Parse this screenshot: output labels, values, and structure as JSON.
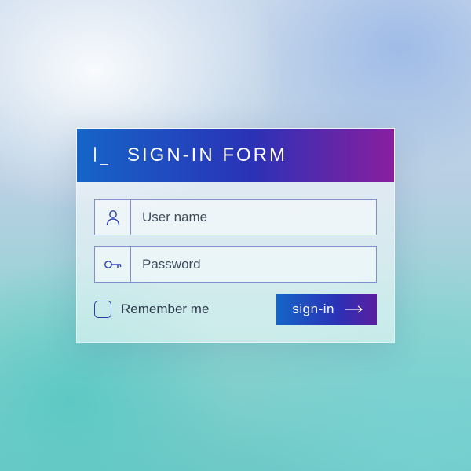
{
  "header": {
    "title": "SIGN-IN FORM"
  },
  "fields": {
    "username_placeholder": "User name",
    "password_placeholder": "Password"
  },
  "remember": {
    "label": "Remember me"
  },
  "button": {
    "label": "sign-in"
  },
  "colors": {
    "gradient_start": "#1565c8",
    "gradient_mid": "#2a32b6",
    "gradient_end": "#8a1ea0",
    "outline": "#2a3cb0"
  }
}
